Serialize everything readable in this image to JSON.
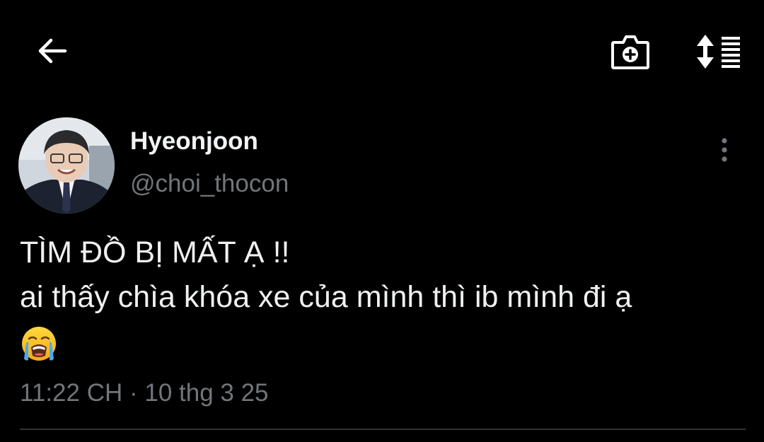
{
  "header": {
    "back_icon": "arrow-left-icon",
    "camera_icon": "camera-plus-icon",
    "sort_icon": "sort-lines-icon"
  },
  "tweet": {
    "display_name": "Hyeonjoon",
    "handle": "@choi_thocon",
    "text_line_1": "TÌM ĐỒ BỊ MẤT Ạ !!",
    "text_line_2": "ai thấy chìa khóa xe của mình thì ib mình đi ạ",
    "emoji": "loudly-crying-face",
    "timestamp": "11:22 CH · 10 thg 3 25",
    "more_icon": "more-vertical-icon"
  },
  "colors": {
    "background": "#000000",
    "primary_text": "#e7e9ea",
    "secondary_text": "#71767b",
    "divider": "#2f3336"
  }
}
